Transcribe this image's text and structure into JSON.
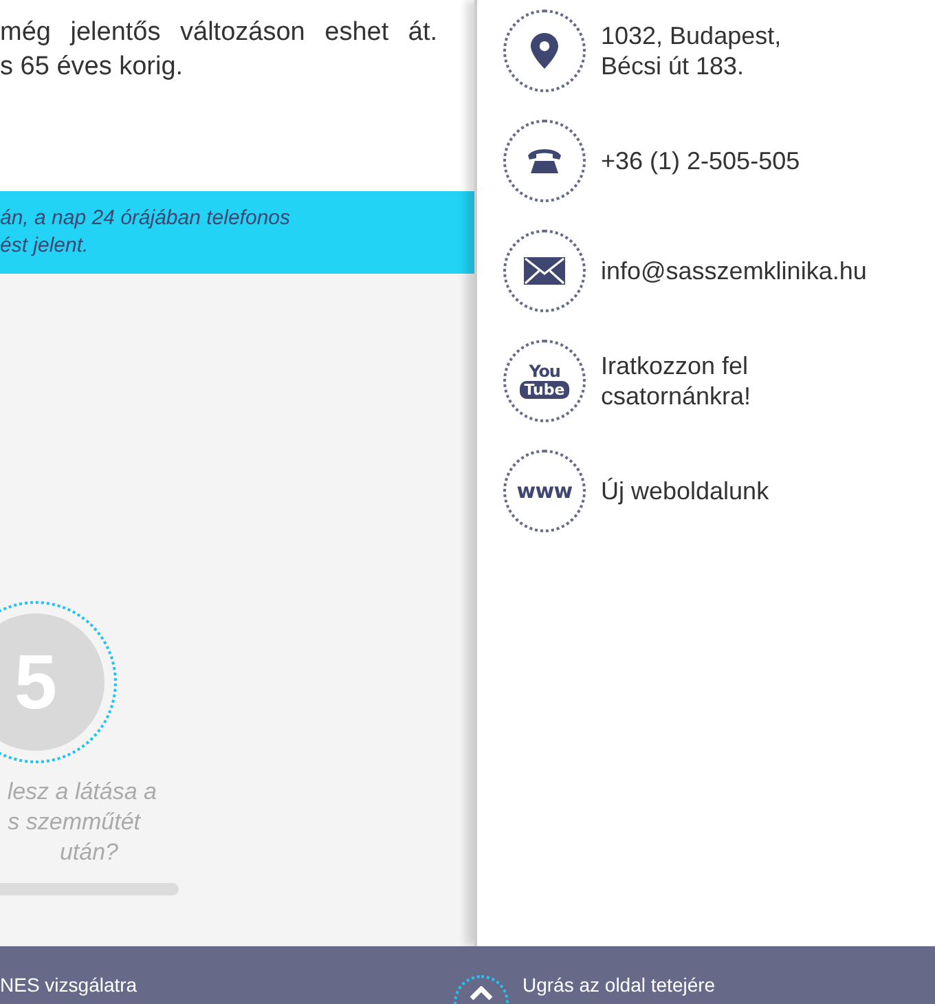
{
  "intro": {
    "lines": [
      "még jelentős változáson eshet át.",
      "s 65 éves korig."
    ]
  },
  "banner": {
    "lines": [
      "án, a nap 24 órájában telefonos",
      "ést jelent."
    ]
  },
  "step": {
    "number": "5",
    "lines": [
      "lesz a látása a",
      "s szemműtét",
      "után?"
    ]
  },
  "contacts": [
    {
      "kind": "pin",
      "lines": [
        "1032, Budapest,",
        "Bécsi út 183."
      ]
    },
    {
      "kind": "phone",
      "lines": [
        "+36 (1) 2-505-505"
      ]
    },
    {
      "kind": "mail",
      "lines": [
        "info@sasszemklinika.hu"
      ]
    },
    {
      "kind": "youtube",
      "icon_text": [
        "You",
        "Tube"
      ],
      "lines": [
        "Iratkozzon fel",
        "csatornánkra!"
      ]
    },
    {
      "kind": "www",
      "icon_text": [
        "www"
      ],
      "lines": [
        "Új weboldalunk"
      ]
    }
  ],
  "footer": {
    "left_link": "NES vizsgálatra",
    "top_link": "Ugrás az oldal tetejére"
  }
}
